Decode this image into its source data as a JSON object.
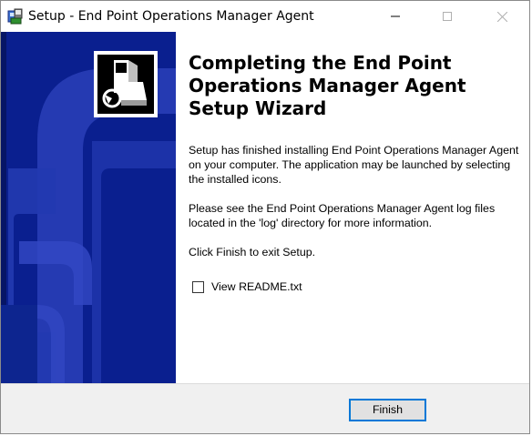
{
  "window": {
    "title": "Setup - End Point Operations Manager Agent"
  },
  "main": {
    "heading": "Completing the End Point Operations Manager Agent Setup Wizard",
    "paragraph1": "Setup has finished installing End Point Operations Manager Agent on your computer. The application may be launched by selecting the installed icons.",
    "paragraph2": "Please see the End Point Operations Manager Agent log files located in the 'log' directory for more information.",
    "paragraph3": "Click Finish to exit Setup.",
    "checkbox": {
      "label": "View README.txt",
      "checked": false
    }
  },
  "footer": {
    "finish_label": "Finish"
  },
  "colors": {
    "banner": "#0a1f8f",
    "banner_light": "#2a3fb8",
    "focus_border": "#0078d7"
  },
  "icons": {
    "app": "setup-installer-icon",
    "wizard": "computer-setup-icon"
  }
}
